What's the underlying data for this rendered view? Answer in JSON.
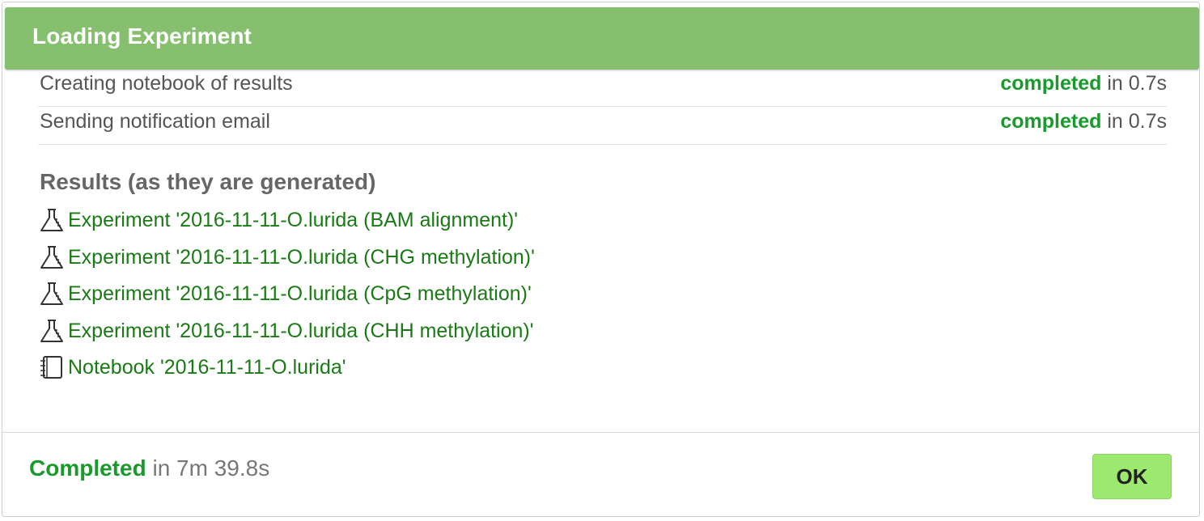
{
  "dialog": {
    "title": "Loading Experiment"
  },
  "steps": [
    {
      "label": "Creating notebook of results",
      "status": "completed",
      "duration_text": "in 0.7s"
    },
    {
      "label": "Sending notification email",
      "status": "completed",
      "duration_text": "in 0.7s"
    }
  ],
  "results": {
    "heading": "Results (as they are generated)",
    "items": [
      {
        "icon": "flask-icon",
        "text": "Experiment '2016-11-11-O.lurida (BAM alignment)'"
      },
      {
        "icon": "flask-icon",
        "text": "Experiment '2016-11-11-O.lurida (CHG methylation)'"
      },
      {
        "icon": "flask-icon",
        "text": "Experiment '2016-11-11-O.lurida (CpG methylation)'"
      },
      {
        "icon": "flask-icon",
        "text": "Experiment '2016-11-11-O.lurida (CHH methylation)'"
      },
      {
        "icon": "notebook-icon",
        "text": "Notebook '2016-11-11-O.lurida'"
      }
    ]
  },
  "footer": {
    "status": "Completed",
    "duration_text": "in 7m 39.8s",
    "ok_label": "OK"
  },
  "colors": {
    "header_bg": "#86bf6e",
    "status_green": "#1a9a2c",
    "link_green": "#1a7a15",
    "ok_button_bg": "#9de86f"
  }
}
